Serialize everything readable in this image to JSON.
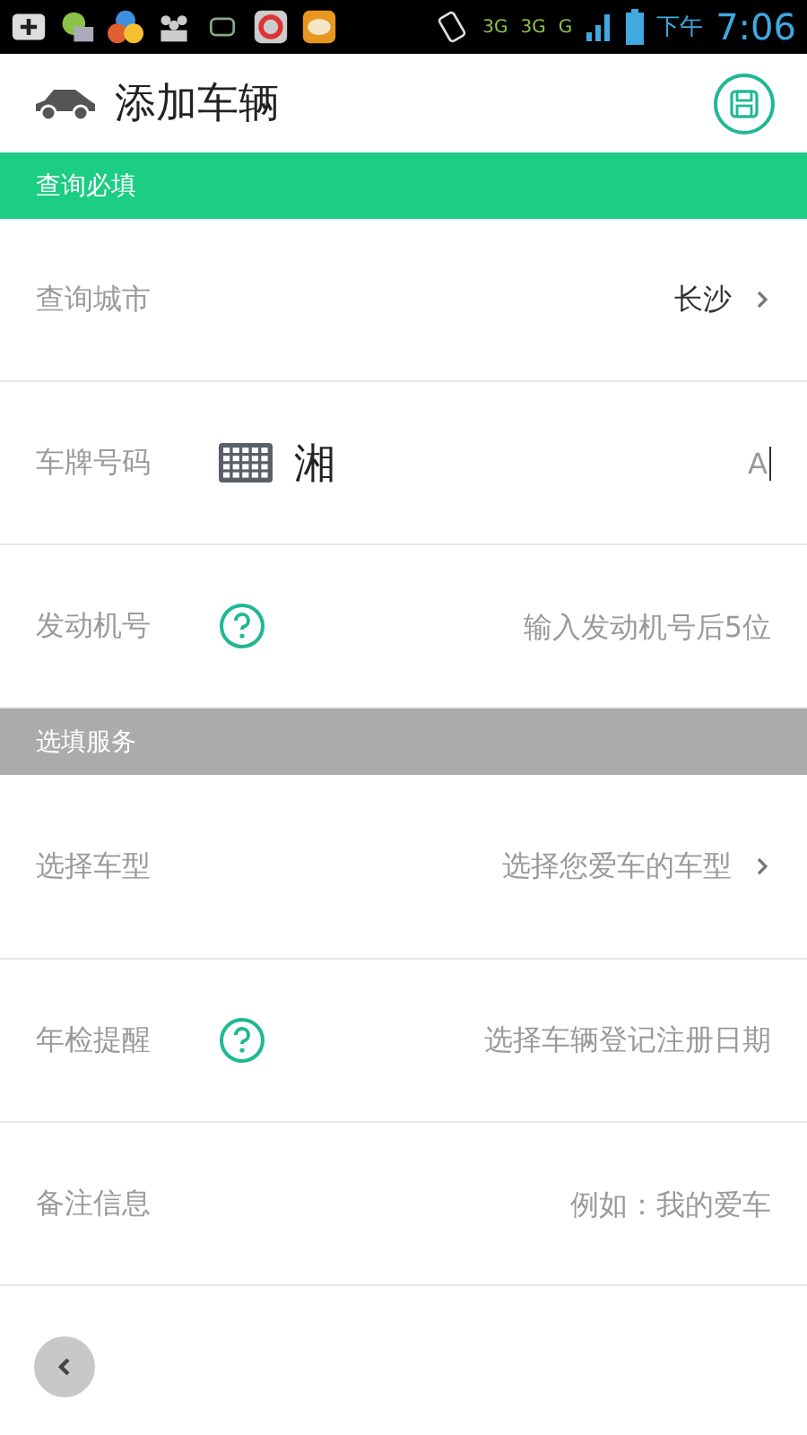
{
  "status_bar": {
    "network_labels": [
      "3G",
      "3G",
      "G"
    ],
    "period": "下午",
    "time": "7:06"
  },
  "header": {
    "title": "添加车辆"
  },
  "sections": [
    {
      "title": "查询必填",
      "kind": "required",
      "rows": [
        {
          "kind": "select",
          "label": "查询城市",
          "value": "长沙",
          "chevron": true,
          "help": false
        },
        {
          "kind": "plate",
          "label": "车牌号码",
          "province": "湘",
          "value": "A",
          "help": false
        },
        {
          "kind": "input",
          "label": "发动机号",
          "placeholder": "输入发动机号后5位",
          "help": true
        }
      ]
    },
    {
      "title": "选填服务",
      "kind": "optional",
      "rows": [
        {
          "kind": "select",
          "label": "选择车型",
          "placeholder": "选择您爱车的车型",
          "chevron": true,
          "help": false
        },
        {
          "kind": "select",
          "label": "年检提醒",
          "placeholder": "选择车辆登记注册日期",
          "chevron": false,
          "help": true
        },
        {
          "kind": "input",
          "label": "备注信息",
          "placeholder": "例如：我的爱车",
          "help": false
        }
      ]
    }
  ]
}
